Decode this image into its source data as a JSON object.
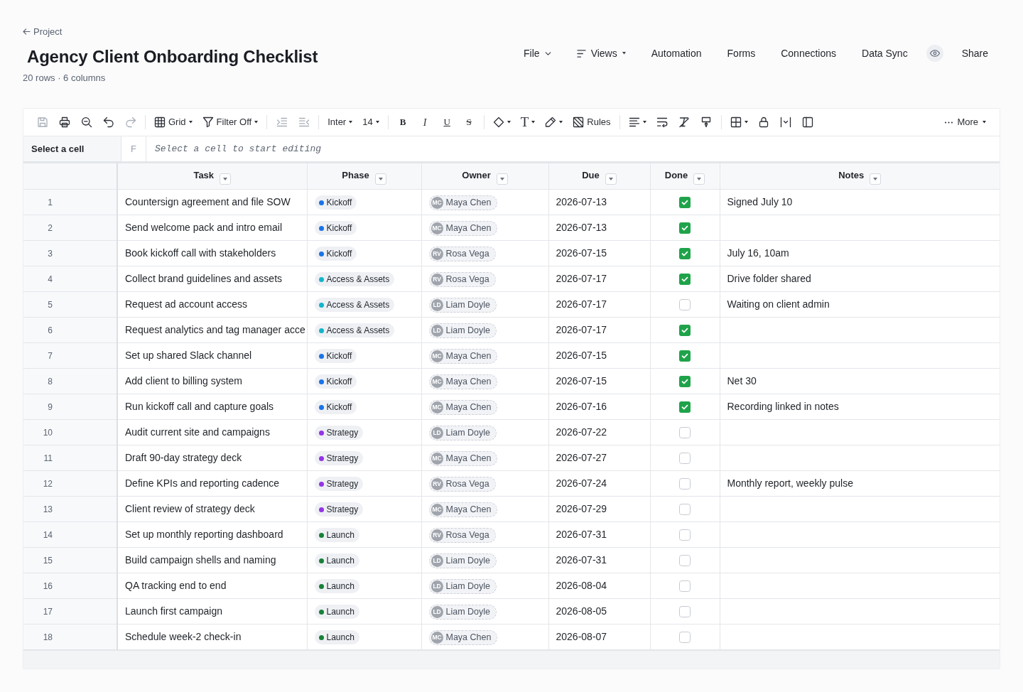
{
  "breadcrumb": {
    "label": "Project"
  },
  "title": "Agency Client Onboarding Checklist",
  "summary": "20 rows · 6 columns",
  "menu": [
    {
      "kind": "dropdown",
      "label": "File"
    },
    {
      "kind": "views",
      "label": "Views"
    },
    {
      "kind": "link",
      "label": "Automation"
    },
    {
      "kind": "link",
      "label": "Forms"
    },
    {
      "kind": "link",
      "label": "Connections"
    },
    {
      "kind": "link",
      "label": "Data Sync"
    },
    {
      "kind": "preview"
    },
    {
      "kind": "link",
      "label": "Share"
    }
  ],
  "toolbar": {
    "groups": [
      {
        "items": [
          {
            "kind": "save",
            "dropdown": false,
            "disabled": true
          },
          {
            "kind": "print",
            "dropdown": false,
            "disabled": false
          },
          {
            "kind": "zoomout",
            "dropdown": false,
            "disabled": false
          },
          {
            "kind": "undo",
            "dropdown": false,
            "disabled": false
          },
          {
            "kind": "redo",
            "dropdown": false,
            "disabled": true
          }
        ]
      },
      {
        "items": [
          {
            "kind": "grid",
            "label": "Grid",
            "dropdown": true,
            "disabled": false
          },
          {
            "kind": "filter",
            "label": "Filter Off",
            "dropdown": true,
            "disabled": false
          }
        ]
      },
      {
        "items": [
          {
            "kind": "indent",
            "dropdown": false,
            "disabled": true
          },
          {
            "kind": "outdent",
            "dropdown": false,
            "disabled": true
          }
        ]
      },
      {
        "items": [
          {
            "kind": "font",
            "label": "Inter",
            "dropdown": true,
            "disabled": false
          },
          {
            "kind": "size",
            "label": "14",
            "dropdown": true,
            "disabled": false
          }
        ]
      },
      {
        "items": [
          {
            "kind": "bold",
            "label": "B",
            "dropdown": false,
            "disabled": false
          },
          {
            "kind": "italic",
            "label": "I",
            "dropdown": false,
            "disabled": false
          },
          {
            "kind": "underline",
            "label": "U",
            "dropdown": false,
            "disabled": false
          },
          {
            "kind": "strike",
            "label": "S",
            "dropdown": false,
            "disabled": false
          }
        ]
      },
      {
        "items": [
          {
            "kind": "fill",
            "dropdown": true,
            "disabled": false
          },
          {
            "kind": "textcolor",
            "label": "T",
            "dropdown": true,
            "disabled": false
          },
          {
            "kind": "highlight",
            "dropdown": true,
            "disabled": false
          },
          {
            "kind": "rules",
            "label": "Rules",
            "dropdown": false,
            "disabled": false
          }
        ]
      },
      {
        "items": [
          {
            "kind": "align",
            "dropdown": true,
            "disabled": false
          },
          {
            "kind": "wrap",
            "dropdown": false,
            "disabled": false
          },
          {
            "kind": "clearformat",
            "dropdown": false,
            "disabled": false
          },
          {
            "kind": "paintformat",
            "dropdown": false,
            "disabled": false
          }
        ]
      },
      {
        "items": [
          {
            "kind": "borders",
            "dropdown": true,
            "disabled": false
          },
          {
            "kind": "lock",
            "dropdown": false,
            "disabled": false
          },
          {
            "kind": "colwidth",
            "dropdown": false,
            "disabled": false
          },
          {
            "kind": "panel",
            "dropdown": false,
            "disabled": false
          }
        ]
      }
    ],
    "more": {
      "kind": "more",
      "label": "More",
      "dropdown": true,
      "disabled": false
    }
  },
  "formula_bar": {
    "cell_reference": "Select a cell",
    "function_label": "F",
    "placeholder": "Select a cell to start editing"
  },
  "table": {
    "columns": [
      {
        "label": "Task"
      },
      {
        "label": "Phase"
      },
      {
        "label": "Owner"
      },
      {
        "label": "Due"
      },
      {
        "label": "Done"
      },
      {
        "label": "Notes"
      }
    ],
    "rows": [
      {
        "number": "1",
        "task": "Countersign agreement and file SOW",
        "phase": {
          "label": "Kickoff",
          "color": "#1a73e8"
        },
        "owner": {
          "initials": "MC",
          "name": "Maya Chen"
        },
        "due": "2026-07-13",
        "done": true,
        "notes": "Signed July 10"
      },
      {
        "number": "2",
        "task": "Send welcome pack and intro email",
        "phase": {
          "label": "Kickoff",
          "color": "#1a73e8"
        },
        "owner": {
          "initials": "MC",
          "name": "Maya Chen"
        },
        "due": "2026-07-13",
        "done": true
      },
      {
        "number": "3",
        "task": "Book kickoff call with stakeholders",
        "phase": {
          "label": "Kickoff",
          "color": "#1a73e8"
        },
        "owner": {
          "initials": "RV",
          "name": "Rosa Vega"
        },
        "due": "2026-07-15",
        "done": true,
        "notes": "July 16, 10am"
      },
      {
        "number": "4",
        "task": "Collect brand guidelines and assets",
        "phase": {
          "label": "Access & Assets",
          "color": "#12b5cb"
        },
        "owner": {
          "initials": "RV",
          "name": "Rosa Vega"
        },
        "due": "2026-07-17",
        "done": true,
        "notes": "Drive folder shared"
      },
      {
        "number": "5",
        "task": "Request ad account access",
        "phase": {
          "label": "Access & Assets",
          "color": "#12b5cb"
        },
        "owner": {
          "initials": "LD",
          "name": "Liam Doyle"
        },
        "due": "2026-07-17",
        "done": false,
        "notes": "Waiting on client admin"
      },
      {
        "number": "6",
        "task": "Request analytics and tag manager acce",
        "phase": {
          "label": "Access & Assets",
          "color": "#12b5cb"
        },
        "owner": {
          "initials": "LD",
          "name": "Liam Doyle"
        },
        "due": "2026-07-17",
        "done": true
      },
      {
        "number": "7",
        "task": "Set up shared Slack channel",
        "phase": {
          "label": "Kickoff",
          "color": "#1a73e8"
        },
        "owner": {
          "initials": "MC",
          "name": "Maya Chen"
        },
        "due": "2026-07-15",
        "done": true
      },
      {
        "number": "8",
        "task": "Add client to billing system",
        "phase": {
          "label": "Kickoff",
          "color": "#1a73e8"
        },
        "owner": {
          "initials": "MC",
          "name": "Maya Chen"
        },
        "due": "2026-07-15",
        "done": true,
        "notes": "Net 30"
      },
      {
        "number": "9",
        "task": "Run kickoff call and capture goals",
        "phase": {
          "label": "Kickoff",
          "color": "#1a73e8"
        },
        "owner": {
          "initials": "MC",
          "name": "Maya Chen"
        },
        "due": "2026-07-16",
        "done": true,
        "notes": "Recording linked in notes"
      },
      {
        "number": "10",
        "task": "Audit current site and campaigns",
        "phase": {
          "label": "Strategy",
          "color": "#9334e6"
        },
        "owner": {
          "initials": "LD",
          "name": "Liam Doyle"
        },
        "due": "2026-07-22",
        "done": false
      },
      {
        "number": "11",
        "task": "Draft 90-day strategy deck",
        "phase": {
          "label": "Strategy",
          "color": "#9334e6"
        },
        "owner": {
          "initials": "MC",
          "name": "Maya Chen"
        },
        "due": "2026-07-27",
        "done": false
      },
      {
        "number": "12",
        "task": "Define KPIs and reporting cadence",
        "phase": {
          "label": "Strategy",
          "color": "#9334e6"
        },
        "owner": {
          "initials": "RV",
          "name": "Rosa Vega"
        },
        "due": "2026-07-24",
        "done": false,
        "notes": "Monthly report, weekly pulse"
      },
      {
        "number": "13",
        "task": "Client review of strategy deck",
        "phase": {
          "label": "Strategy",
          "color": "#9334e6"
        },
        "owner": {
          "initials": "MC",
          "name": "Maya Chen"
        },
        "due": "2026-07-29",
        "done": false
      },
      {
        "number": "14",
        "task": "Set up monthly reporting dashboard",
        "phase": {
          "label": "Launch",
          "color": "#188038"
        },
        "owner": {
          "initials": "RV",
          "name": "Rosa Vega"
        },
        "due": "2026-07-31",
        "done": false
      },
      {
        "number": "15",
        "task": "Build campaign shells and naming",
        "phase": {
          "label": "Launch",
          "color": "#188038"
        },
        "owner": {
          "initials": "LD",
          "name": "Liam Doyle"
        },
        "due": "2026-07-31",
        "done": false
      },
      {
        "number": "16",
        "task": "QA tracking end to end",
        "phase": {
          "label": "Launch",
          "color": "#188038"
        },
        "owner": {
          "initials": "LD",
          "name": "Liam Doyle"
        },
        "due": "2026-08-04",
        "done": false
      },
      {
        "number": "17",
        "task": "Launch first campaign",
        "phase": {
          "label": "Launch",
          "color": "#188038"
        },
        "owner": {
          "initials": "LD",
          "name": "Liam Doyle"
        },
        "due": "2026-08-05",
        "done": false
      },
      {
        "number": "18",
        "task": "Schedule week-2 check-in",
        "phase": {
          "label": "Launch",
          "color": "#188038"
        },
        "owner": {
          "initials": "MC",
          "name": "Maya Chen"
        },
        "due": "2026-08-07",
        "done": false
      }
    ]
  }
}
